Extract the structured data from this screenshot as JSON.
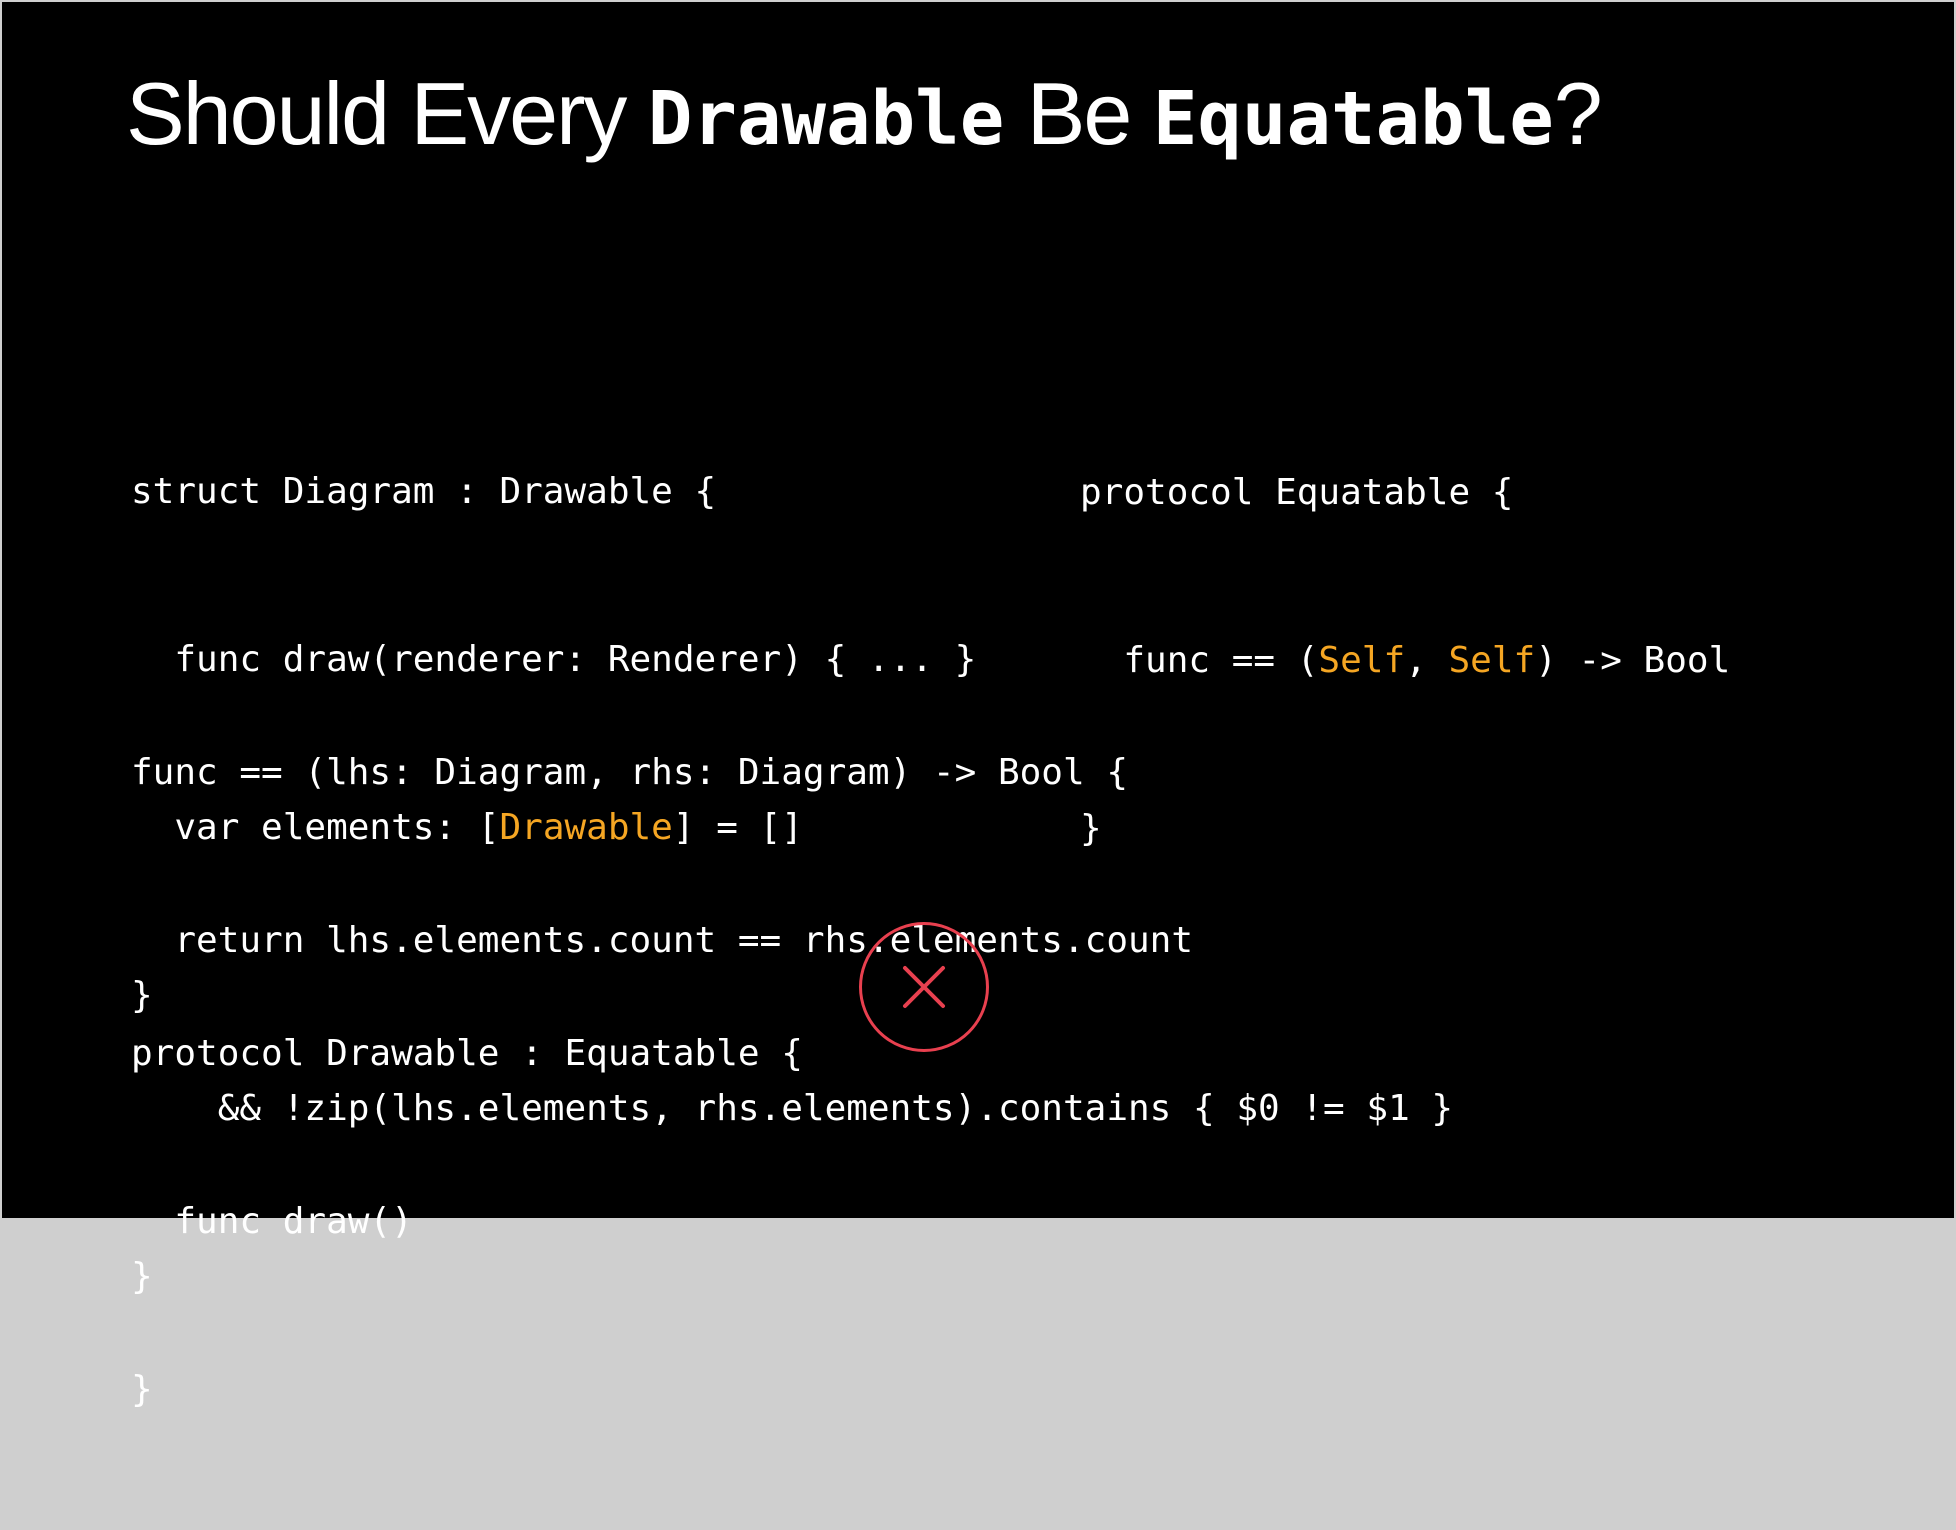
{
  "slide": {
    "title": {
      "part1": "Should Every ",
      "part2": "Drawable",
      "part3": " Be ",
      "part4": "Equatable",
      "part5": "?"
    },
    "code_left_top": [
      "struct Diagram : Drawable {",
      "  func draw(renderer: Renderer) { ... }",
      "  var elements: [",
      "Drawable",
      "] = []",
      "}"
    ],
    "code_right_top": [
      "protocol Equatable {",
      "  func == (",
      "Self",
      ", ",
      "Self",
      ") -> Bool",
      "}"
    ],
    "code_middle": [
      "func == (lhs: Diagram, rhs: Diagram) -> Bool {",
      "  return lhs.elements.count == rhs.elements.count",
      "    && !zip(lhs.elements, rhs.elements).contains { $0 != $1 }",
      "}"
    ],
    "code_bottom": [
      "protocol Drawable : Equatable {",
      "  func draw()",
      "}"
    ],
    "colors": {
      "background": "#000000",
      "text": "#ffffff",
      "highlight": "#f5a623",
      "reject": "#e8404f"
    },
    "icon": "x-circle-icon"
  }
}
